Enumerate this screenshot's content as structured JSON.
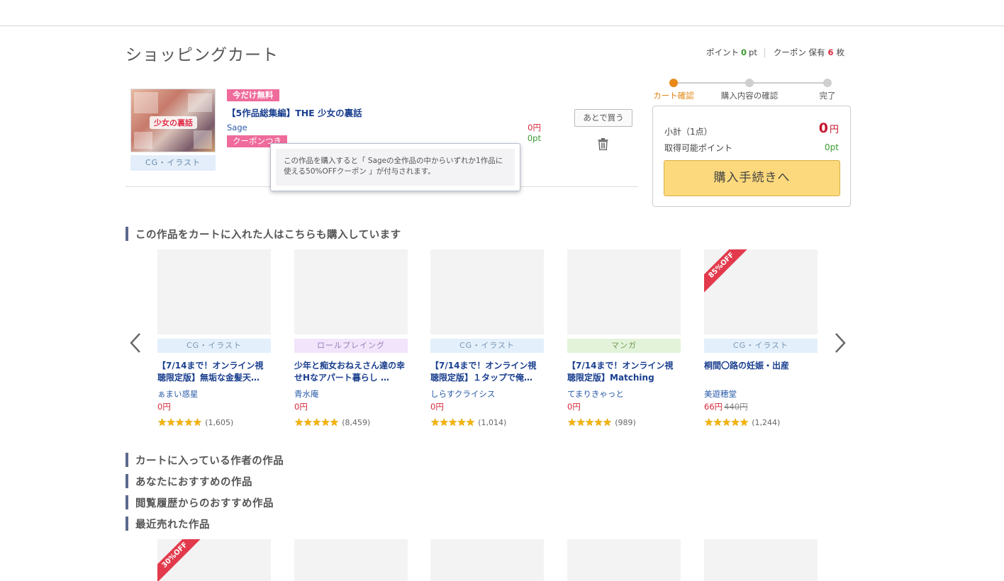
{
  "page": {
    "title": "ショッピングカート"
  },
  "account": {
    "points_label": "ポイント",
    "points_value": "0",
    "points_unit": "pt",
    "coupon_label": "クーポン 保有",
    "coupon_value": "6",
    "coupon_unit": "枚"
  },
  "cart_item": {
    "badge_free": "今だけ無料",
    "title": "【5作品総集編】THE 少女の裏話",
    "circle": "Sage",
    "badge_coupon": "クーポンつき",
    "genre": "CG・イラスト",
    "thumb_logo": "少女の裏話",
    "price": "0円",
    "points": "0pt",
    "later_button": "あとで買う",
    "tooltip": "この作品を購入すると「 Sageの全作品の中からいずれか1作品に使える50%OFFクーポン 」が付与されます。"
  },
  "steps": [
    "カート確認",
    "購入内容の確認",
    "完了"
  ],
  "summary": {
    "subtotal_label": "小計（1点）",
    "subtotal_value": "0",
    "subtotal_unit": "円",
    "points_label": "取得可能ポイント",
    "points_value": "0pt",
    "buy_button": "購入手続きへ"
  },
  "sections": {
    "also_bought": "この作品をカートに入れた人はこちらも購入しています",
    "author_works": "カートに入っている作者の作品",
    "recommended": "あなたにおすすめの作品",
    "history": "閲覧履歴からのおすすめ作品",
    "recent_sales": "最近売れた作品"
  },
  "products": [
    {
      "genre": "CG・イラスト",
      "genre_class": "cg",
      "title": "【7/14まで！オンライン視聴限定版】無垢な金髪天…",
      "circle": "ぁまい惑星",
      "price": "0円",
      "old_price": "",
      "rating": 4.5,
      "reviews": "(1,605)",
      "ribbon": ""
    },
    {
      "genre": "ロールプレイング",
      "genre_class": "rpg",
      "title": "少年と痴女おねえさん達の幸せHなアパート暮らし …",
      "circle": "青水庵",
      "price": "0円",
      "old_price": "",
      "rating": 4.5,
      "reviews": "(8,459)",
      "ribbon": ""
    },
    {
      "genre": "CG・イラスト",
      "genre_class": "cg",
      "title": "【7/14まで！オンライン視聴限定版】１タップで俺…",
      "circle": "しらすクライシス",
      "price": "0円",
      "old_price": "",
      "rating": 4.5,
      "reviews": "(1,014)",
      "ribbon": ""
    },
    {
      "genre": "マンガ",
      "genre_class": "manga",
      "title": "【7/14まで！オンライン視聴限定版】Matching",
      "circle": "てまりきゃっと",
      "price": "0円",
      "old_price": "",
      "rating": 4.5,
      "reviews": "(989)",
      "ribbon": ""
    },
    {
      "genre": "CG・イラスト",
      "genre_class": "cg",
      "title": "桐間〇路の妊娠・出産",
      "circle": "美遊穂堂",
      "price": "66円",
      "old_price": "440円",
      "rating": 4.5,
      "reviews": "(1,244)",
      "ribbon": "85%OFF"
    }
  ],
  "bottom_products": [
    {
      "ribbon": "30%OFF"
    },
    {
      "ribbon": ""
    },
    {
      "ribbon": ""
    },
    {
      "ribbon": ""
    },
    {
      "ribbon": ""
    }
  ],
  "colors": {
    "accent_orange": "#e8891a",
    "price_red": "#d6283c",
    "point_green": "#3a9a2f",
    "badge_pink": "#ef6b9b",
    "buy_button": "#fcd97c",
    "link_blue": "#1a3f8f"
  },
  "icons": {
    "trash": "trash-icon",
    "prev": "chevron-left-icon",
    "next": "chevron-right-icon",
    "star": "star-icon"
  }
}
